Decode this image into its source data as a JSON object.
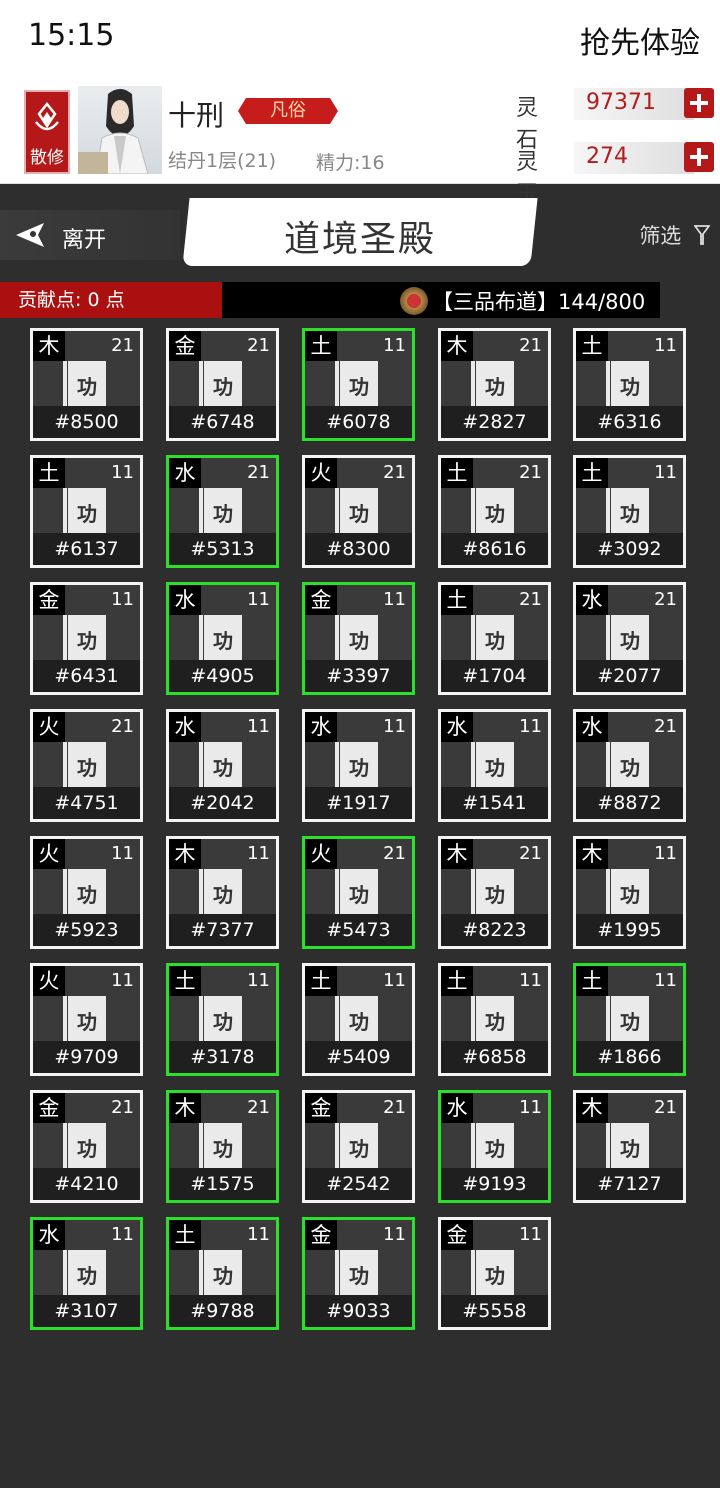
{
  "status_bar": {
    "time": "15:15",
    "promo": "抢先体验"
  },
  "player": {
    "sect_label": "散修",
    "name": "十刑",
    "rank": "凡俗",
    "realm": "结丹1层(21)",
    "energy": "精力:16"
  },
  "resources": [
    {
      "label": "灵石",
      "value": "97371"
    },
    {
      "label": "灵玉",
      "value": "274"
    }
  ],
  "nav": {
    "leave_label": "离开",
    "title": "道境圣殿",
    "filter_label": "筛选"
  },
  "info": {
    "contribution": "贡献点: 0 点",
    "buddha_progress": "【三品布道】144/800"
  },
  "book_glyph": "功",
  "colors": {
    "selected_border": "#2bdf2b",
    "normal_border": "#f4f4f4",
    "accent_red": "#b41818"
  },
  "cards": [
    {
      "element": "木",
      "level": "21",
      "id": "#8500",
      "selected": false
    },
    {
      "element": "金",
      "level": "21",
      "id": "#6748",
      "selected": false
    },
    {
      "element": "土",
      "level": "11",
      "id": "#6078",
      "selected": true
    },
    {
      "element": "木",
      "level": "21",
      "id": "#2827",
      "selected": false
    },
    {
      "element": "土",
      "level": "11",
      "id": "#6316",
      "selected": false
    },
    {
      "element": "土",
      "level": "11",
      "id": "#6137",
      "selected": false
    },
    {
      "element": "水",
      "level": "21",
      "id": "#5313",
      "selected": true
    },
    {
      "element": "火",
      "level": "21",
      "id": "#8300",
      "selected": false
    },
    {
      "element": "土",
      "level": "21",
      "id": "#8616",
      "selected": false
    },
    {
      "element": "土",
      "level": "11",
      "id": "#3092",
      "selected": false
    },
    {
      "element": "金",
      "level": "11",
      "id": "#6431",
      "selected": false
    },
    {
      "element": "水",
      "level": "11",
      "id": "#4905",
      "selected": true
    },
    {
      "element": "金",
      "level": "11",
      "id": "#3397",
      "selected": true
    },
    {
      "element": "土",
      "level": "21",
      "id": "#1704",
      "selected": false
    },
    {
      "element": "水",
      "level": "21",
      "id": "#2077",
      "selected": false
    },
    {
      "element": "火",
      "level": "21",
      "id": "#4751",
      "selected": false
    },
    {
      "element": "水",
      "level": "11",
      "id": "#2042",
      "selected": false
    },
    {
      "element": "水",
      "level": "11",
      "id": "#1917",
      "selected": false
    },
    {
      "element": "水",
      "level": "11",
      "id": "#1541",
      "selected": false
    },
    {
      "element": "水",
      "level": "21",
      "id": "#8872",
      "selected": false
    },
    {
      "element": "火",
      "level": "11",
      "id": "#5923",
      "selected": false
    },
    {
      "element": "木",
      "level": "11",
      "id": "#7377",
      "selected": false
    },
    {
      "element": "火",
      "level": "21",
      "id": "#5473",
      "selected": true
    },
    {
      "element": "木",
      "level": "21",
      "id": "#8223",
      "selected": false
    },
    {
      "element": "木",
      "level": "11",
      "id": "#1995",
      "selected": false
    },
    {
      "element": "火",
      "level": "11",
      "id": "#9709",
      "selected": false
    },
    {
      "element": "土",
      "level": "11",
      "id": "#3178",
      "selected": true
    },
    {
      "element": "土",
      "level": "11",
      "id": "#5409",
      "selected": false
    },
    {
      "element": "土",
      "level": "11",
      "id": "#6858",
      "selected": false
    },
    {
      "element": "土",
      "level": "11",
      "id": "#1866",
      "selected": true
    },
    {
      "element": "金",
      "level": "21",
      "id": "#4210",
      "selected": false
    },
    {
      "element": "木",
      "level": "21",
      "id": "#1575",
      "selected": true
    },
    {
      "element": "金",
      "level": "21",
      "id": "#2542",
      "selected": false
    },
    {
      "element": "水",
      "level": "11",
      "id": "#9193",
      "selected": true
    },
    {
      "element": "木",
      "level": "21",
      "id": "#7127",
      "selected": false
    },
    {
      "element": "水",
      "level": "11",
      "id": "#3107",
      "selected": true
    },
    {
      "element": "土",
      "level": "11",
      "id": "#9788",
      "selected": true
    },
    {
      "element": "金",
      "level": "11",
      "id": "#9033",
      "selected": true
    },
    {
      "element": "金",
      "level": "11",
      "id": "#5558",
      "selected": false
    }
  ]
}
